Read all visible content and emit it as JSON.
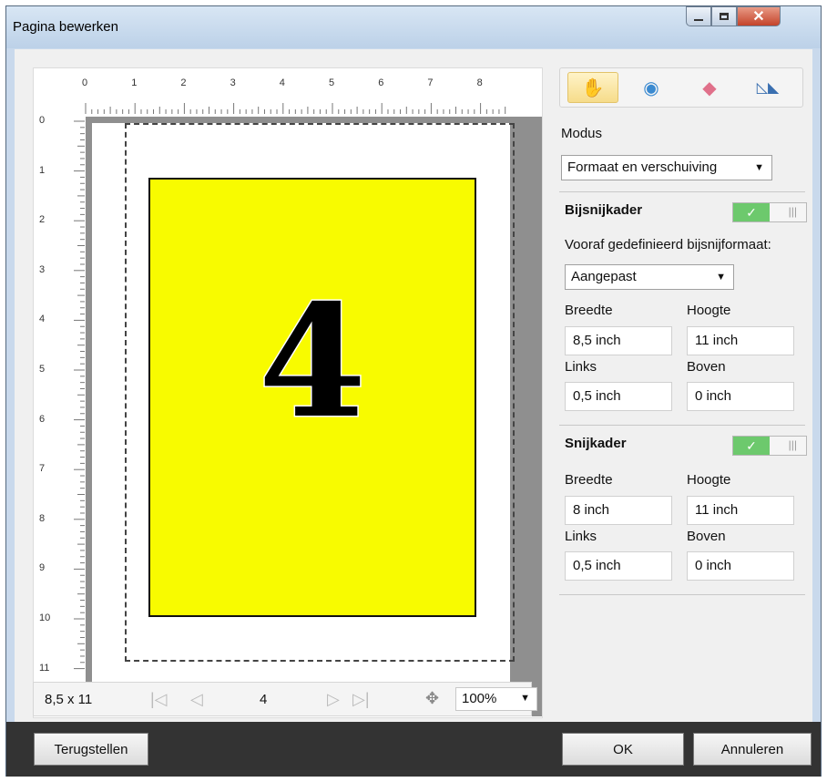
{
  "window": {
    "title": "Pagina bewerken"
  },
  "rulers": {
    "top": [
      "0",
      "1",
      "2",
      "3",
      "4",
      "5",
      "6",
      "7",
      "8"
    ],
    "left": [
      "0",
      "1",
      "2",
      "3",
      "4",
      "5",
      "6",
      "7",
      "8",
      "9",
      "10",
      "11"
    ]
  },
  "preview": {
    "page_number_glyph": "4",
    "artwork_color": "#f8fb00"
  },
  "navigation": {
    "page_size": "8,5 x 11",
    "current_page": "4",
    "zoom": "100%"
  },
  "tools": [
    "hand-icon",
    "zoom-icon",
    "eraser-icon",
    "flip-icon"
  ],
  "mode": {
    "label": "Modus",
    "value": "Formaat en verschuiving"
  },
  "bleed_box": {
    "title": "Bijsnijkader",
    "enabled": true,
    "preset_label": "Vooraf gedefinieerd bijsnijformaat:",
    "preset_value": "Aangepast",
    "width_label": "Breedte",
    "width": "8,5 inch",
    "height_label": "Hoogte",
    "height": "11 inch",
    "left_label": "Links",
    "left": "0,5 inch",
    "top_label": "Boven",
    "top": "0 inch"
  },
  "trim_box": {
    "title": "Snijkader",
    "enabled": true,
    "width_label": "Breedte",
    "width": "8 inch",
    "height_label": "Hoogte",
    "height": "11 inch",
    "left_label": "Links",
    "left": "0,5 inch",
    "top_label": "Boven",
    "top": "0 inch"
  },
  "buttons": {
    "reset": "Terugstellen",
    "ok": "OK",
    "cancel": "Annuleren"
  }
}
